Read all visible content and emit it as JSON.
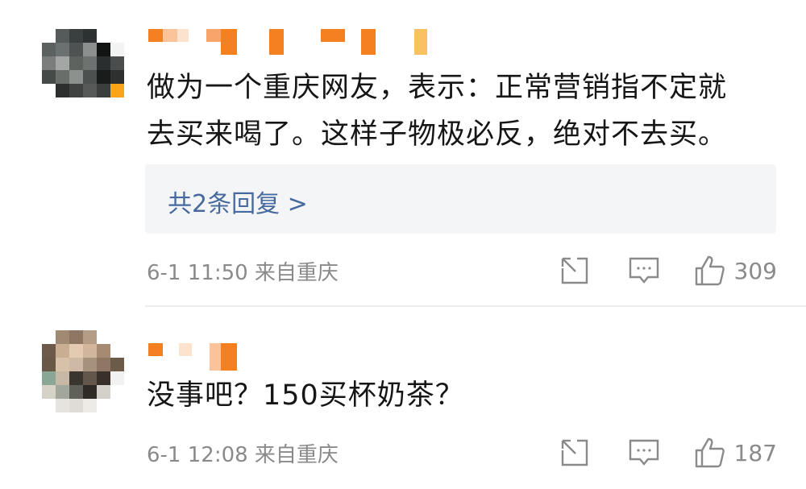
{
  "comments": [
    {
      "text_line1": "做为一个重庆网友，表示：正常营销指不定就",
      "text_line2": "去买来喝了。这样子物极必反，绝对不去买。",
      "replies_label": "共2条回复 >",
      "meta": "6-1 11:50 来自重庆",
      "like_count": "309"
    },
    {
      "text_line1": "没事吧？150买杯奶茶？",
      "meta": "6-1 12:08 来自重庆",
      "like_count": "187"
    }
  ],
  "icons": {
    "share": "share-icon",
    "comment": "comment-icon",
    "like": "thumbs-up-icon"
  },
  "colors": {
    "link": "#476a9e",
    "meta": "#8a8a8a",
    "reply_bg": "#f4f5f7",
    "name_mosaic": "#f5801f"
  }
}
